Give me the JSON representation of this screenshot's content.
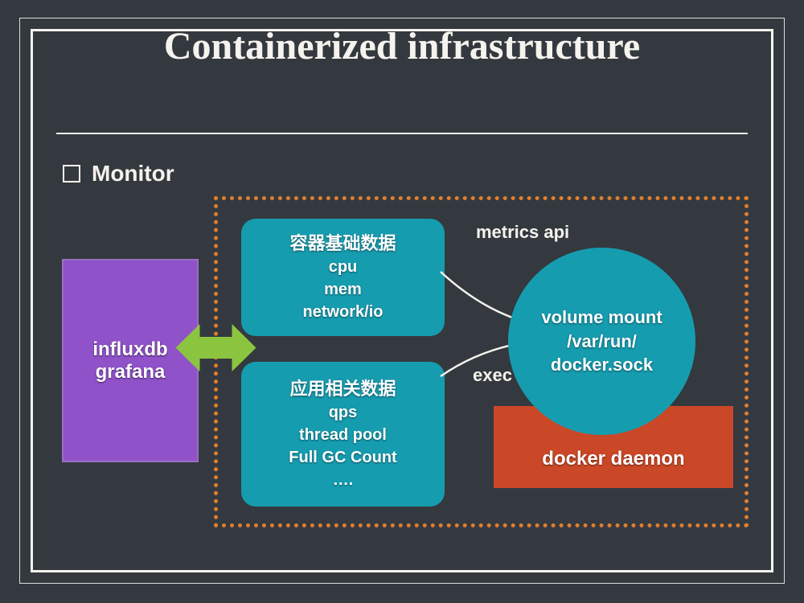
{
  "title": "Containerized infrastructure",
  "section": "Monitor",
  "store": {
    "line1": "influxdb",
    "line2": "grafana"
  },
  "metricsBox": {
    "title": "容器基础数据",
    "l1": "cpu",
    "l2": "mem",
    "l3": "network/io"
  },
  "appBox": {
    "title": "应用相关数据",
    "l1": "qps",
    "l2": "thread pool",
    "l3": "Full GC Count",
    "l4": "…."
  },
  "circle": {
    "l1": "volume mount",
    "l2": "/var/run/",
    "l3": "docker.sock"
  },
  "daemon": "docker daemon",
  "labels": {
    "metrics": "metrics api",
    "exec": "exec"
  }
}
